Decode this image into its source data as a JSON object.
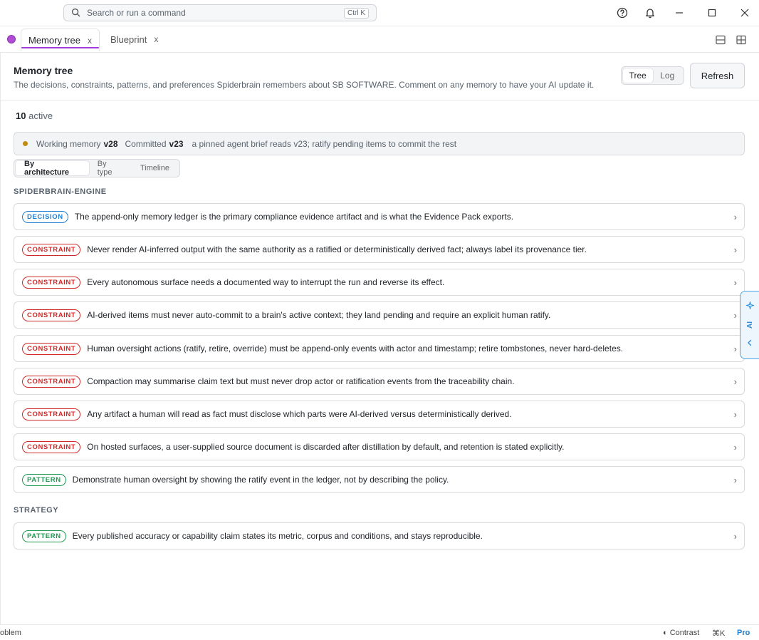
{
  "titlebar": {
    "search_placeholder": "Search or run a command",
    "search_shortcut": "Ctrl K",
    "icons": [
      "help-icon",
      "bell-icon",
      "minimize-icon",
      "maximize-icon",
      "close-icon"
    ]
  },
  "tabs": [
    {
      "label": "Memory tree",
      "close": "x",
      "active": true
    },
    {
      "label": "Blueprint",
      "close": "x",
      "active": false
    }
  ],
  "header": {
    "title": "Memory tree",
    "subtitle": "The decisions, constraints, patterns, and preferences Spiderbrain remembers about SB SOFTWARE. Comment on any memory to have your AI update it.",
    "view_toggle": [
      "Tree",
      "Log"
    ],
    "refresh_label": "Refresh"
  },
  "count": {
    "number": "10",
    "label": "active"
  },
  "working_memory": {
    "status_color": "#c08a13",
    "working_label": "Working memory",
    "working_version": "v28",
    "committed_label": "Committed",
    "committed_version": "v23",
    "note": "a pinned agent brief reads v23; ratify pending items to commit the rest"
  },
  "views": [
    "By architecture",
    "By type",
    "Timeline"
  ],
  "sections": [
    {
      "title": "SPIDERBRAIN-ENGINE",
      "items": [
        {
          "type": "DECISION",
          "text": "The append-only memory ledger is the primary compliance evidence artifact and is what the Evidence Pack exports."
        },
        {
          "type": "CONSTRAINT",
          "text": "Never render AI-inferred output with the same authority as a ratified or deterministically derived fact; always label its provenance tier."
        },
        {
          "type": "CONSTRAINT",
          "text": "Every autonomous surface needs a documented way to interrupt the run and reverse its effect."
        },
        {
          "type": "CONSTRAINT",
          "text": "AI-derived items must never auto-commit to a brain's active context; they land pending and require an explicit human ratify."
        },
        {
          "type": "CONSTRAINT",
          "text": "Human oversight actions (ratify, retire, override) must be append-only events with actor and timestamp; retire tombstones, never hard-deletes."
        },
        {
          "type": "CONSTRAINT",
          "text": "Compaction may summarise claim text but must never drop actor or ratification events from the traceability chain."
        },
        {
          "type": "CONSTRAINT",
          "text": "Any artifact a human will read as fact must disclose which parts were AI-derived versus deterministically derived."
        },
        {
          "type": "CONSTRAINT",
          "text": "On hosted surfaces, a user-supplied source document is discarded after distillation by default, and retention is stated explicitly."
        },
        {
          "type": "PATTERN",
          "text": "Demonstrate human oversight by showing the ratify event in the ledger, not by describing the policy."
        }
      ]
    },
    {
      "title": "STRATEGY",
      "items": [
        {
          "type": "PATTERN",
          "text": "Every published accuracy or capability claim states its metric, corpus and conditions, and stays reproducible."
        }
      ]
    }
  ],
  "ai_handle": {
    "label": "AI"
  },
  "statusbar": {
    "left": "oblem",
    "contrast": "◐ Contrast",
    "shortcut": "⌘K",
    "plan": "Pro"
  }
}
